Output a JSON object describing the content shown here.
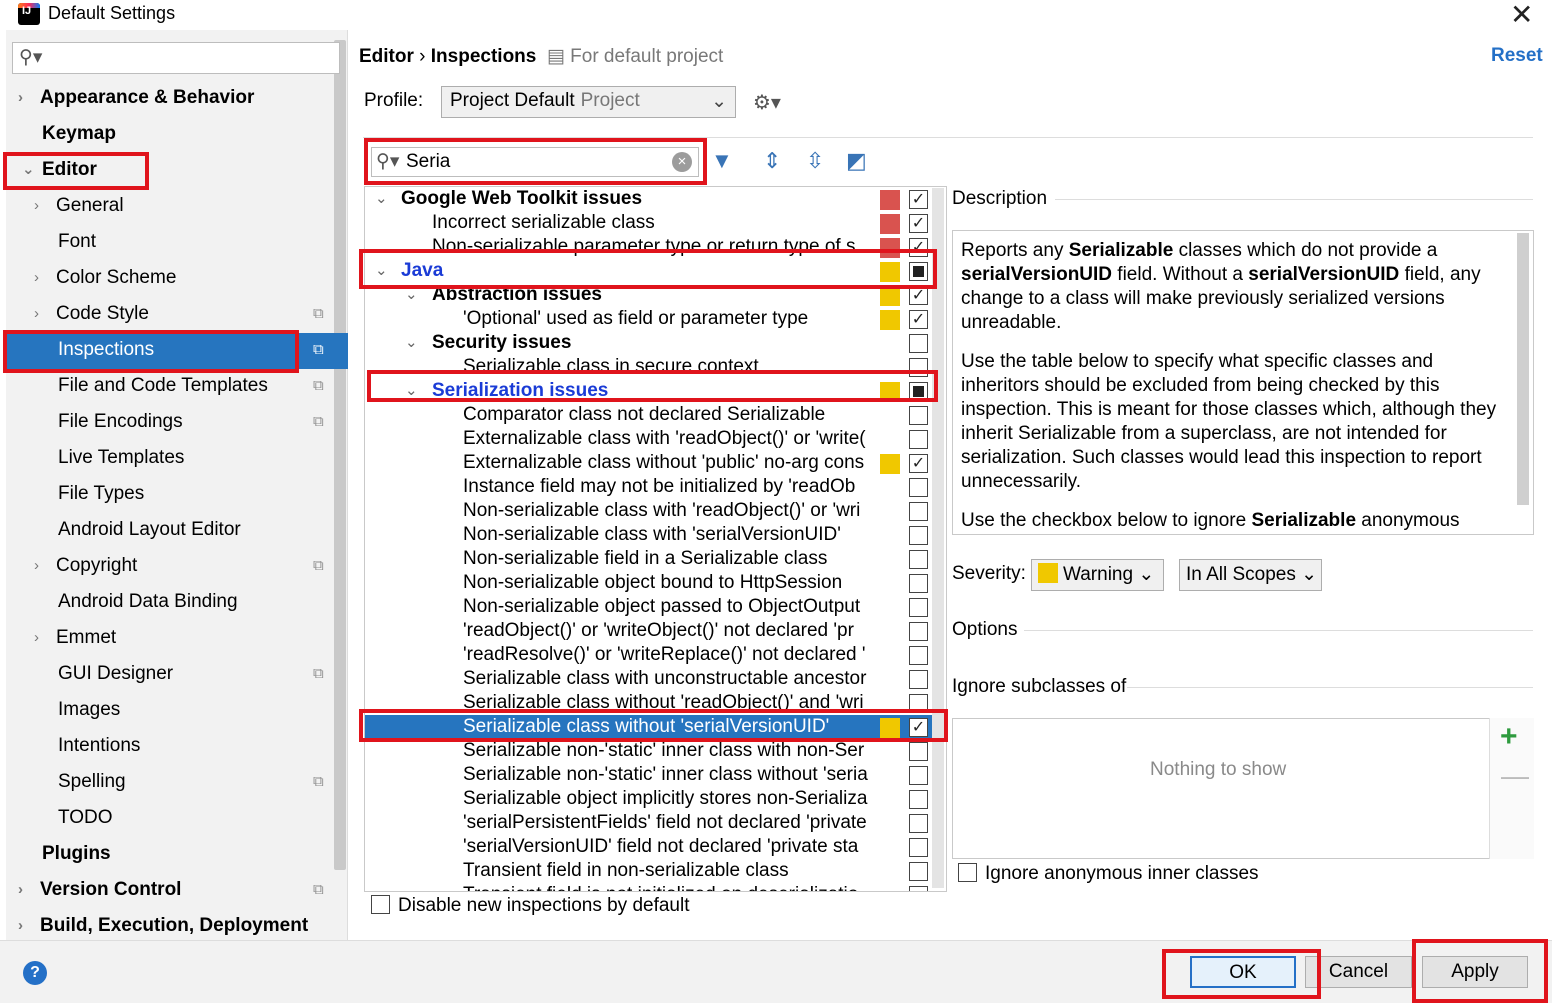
{
  "window": {
    "title": "Default Settings",
    "close_icon": "close-icon"
  },
  "colors": {
    "selection": "#2675bf",
    "annotation_red": "#e0141c",
    "warning_yellow": "#f0c800",
    "error_red": "#d9534f",
    "link_blue": "#2470c7"
  },
  "sidebar": {
    "search_placeholder": "",
    "items": [
      {
        "label": "Appearance & Behavior"
      },
      {
        "label": "Keymap"
      },
      {
        "label": "Editor"
      },
      {
        "label": "General"
      },
      {
        "label": "Font"
      },
      {
        "label": "Color Scheme"
      },
      {
        "label": "Code Style"
      },
      {
        "label": "Inspections"
      },
      {
        "label": "File and Code Templates"
      },
      {
        "label": "File Encodings"
      },
      {
        "label": "Live Templates"
      },
      {
        "label": "File Types"
      },
      {
        "label": "Android Layout Editor"
      },
      {
        "label": "Copyright"
      },
      {
        "label": "Android Data Binding"
      },
      {
        "label": "Emmet"
      },
      {
        "label": "GUI Designer"
      },
      {
        "label": "Images"
      },
      {
        "label": "Intentions"
      },
      {
        "label": "Spelling"
      },
      {
        "label": "TODO"
      },
      {
        "label": "Plugins"
      },
      {
        "label": "Version Control"
      },
      {
        "label": "Build, Execution, Deployment"
      }
    ]
  },
  "header": {
    "breadcrumb_editor": "Editor",
    "breadcrumb_sep": "›",
    "breadcrumb_inspections": "Inspections",
    "hint": "For default project",
    "reset": "Reset"
  },
  "profile": {
    "label": "Profile:",
    "value": "Project Default",
    "sub": "Project"
  },
  "inspection_search": {
    "value": "Seria"
  },
  "inspections": [
    {
      "label": "Google Web Toolkit issues",
      "severity": "#d9534f",
      "checked": "full"
    },
    {
      "label": "Incorrect serializable class",
      "severity": "#d9534f",
      "checked": "full"
    },
    {
      "label": "Non-serializable parameter type or return type of s",
      "severity": "#d9534f",
      "checked": "full"
    },
    {
      "label": "Java",
      "severity": "#f0c800",
      "checked": "partial"
    },
    {
      "label": "Abstraction issues",
      "severity": "#f0c800",
      "checked": "full"
    },
    {
      "label": "'Optional' used as field or parameter type",
      "severity": "#f0c800",
      "checked": "full"
    },
    {
      "label": "Security issues",
      "severity": "",
      "checked": "none"
    },
    {
      "label": "Serializable class in secure context",
      "severity": "",
      "checked": "none"
    },
    {
      "label": "Serialization issues",
      "severity": "#f0c800",
      "checked": "partial"
    },
    {
      "label": "Comparator class not declared Serializable",
      "severity": "",
      "checked": "none"
    },
    {
      "label": "Externalizable class with 'readObject()' or 'write(",
      "severity": "",
      "checked": "none"
    },
    {
      "label": "Externalizable class without 'public' no-arg cons",
      "severity": "#f0c800",
      "checked": "full"
    },
    {
      "label": "Instance field may not be initialized by 'readOb",
      "severity": "",
      "checked": "none"
    },
    {
      "label": "Non-serializable class with 'readObject()' or 'wri",
      "severity": "",
      "checked": "none"
    },
    {
      "label": "Non-serializable class with 'serialVersionUID'",
      "severity": "",
      "checked": "none"
    },
    {
      "label": "Non-serializable field in a Serializable class",
      "severity": "",
      "checked": "none"
    },
    {
      "label": "Non-serializable object bound to HttpSession",
      "severity": "",
      "checked": "none"
    },
    {
      "label": "Non-serializable object passed to ObjectOutput",
      "severity": "",
      "checked": "none"
    },
    {
      "label": "'readObject()' or 'writeObject()' not declared 'pr",
      "severity": "",
      "checked": "none"
    },
    {
      "label": "'readResolve()' or 'writeReplace()' not declared '",
      "severity": "",
      "checked": "none"
    },
    {
      "label": "Serializable class with unconstructable ancestor",
      "severity": "",
      "checked": "none"
    },
    {
      "label": "Serializable class without 'readObject()' and 'wri",
      "severity": "",
      "checked": "none"
    },
    {
      "label": "Serializable class without 'serialVersionUID'",
      "severity": "#f0c800",
      "checked": "full"
    },
    {
      "label": "Serializable non-'static' inner class with non-Ser",
      "severity": "",
      "checked": "none"
    },
    {
      "label": "Serializable non-'static' inner class without 'seria",
      "severity": "",
      "checked": "none"
    },
    {
      "label": "Serializable object implicitly stores non-Serializa",
      "severity": "",
      "checked": "none"
    },
    {
      "label": "'serialPersistentFields' field not declared 'private",
      "severity": "",
      "checked": "none"
    },
    {
      "label": "'serialVersionUID' field not declared 'private sta",
      "severity": "",
      "checked": "none"
    },
    {
      "label": "Transient field in non-serializable class",
      "severity": "",
      "checked": "none"
    },
    {
      "label": "Transient field is not initialized on deserializatio",
      "severity": "",
      "checked": "none"
    }
  ],
  "disable_new": "Disable new inspections by default",
  "description": {
    "label": "Description",
    "p1_a": "Reports any ",
    "p1_b": "Serializable",
    "p1_c": " classes which do not provide a ",
    "p1_d": "serialVersionUID",
    "p1_e": " field. Without a ",
    "p1_f": "serialVersionUID",
    "p1_g": " field, any change to a class will make previously serialized versions unreadable.",
    "p2": "Use the table below to specify what specific classes and inheritors should be excluded from being checked by this inspection. This is meant for those classes which, although they inherit Serializable from a superclass, are not intended for serialization. Such classes would lead this inspection to report unnecessarily.",
    "p3_a": "Use the checkbox below to ignore ",
    "p3_b": "Serializable",
    "p3_c": " anonymous"
  },
  "severity": {
    "label": "Severity:",
    "value": "Warning",
    "scope": "In All Scopes"
  },
  "options": {
    "label": "Options",
    "ignore_label": "Ignore subclasses of",
    "empty": "Nothing to show",
    "ignore_anon": "Ignore anonymous inner classes"
  },
  "buttons": {
    "ok": "OK",
    "cancel": "Cancel",
    "apply": "Apply",
    "help": "?"
  }
}
